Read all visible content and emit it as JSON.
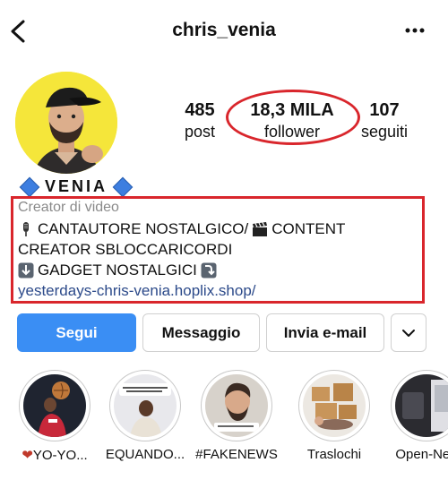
{
  "header": {
    "username": "chris_venia"
  },
  "stats": {
    "posts": {
      "value": "485",
      "label": "post"
    },
    "followers": {
      "value": "18,3 MILA",
      "label": "follower"
    },
    "following": {
      "value": "107",
      "label": "seguiti"
    }
  },
  "profile": {
    "display_name": "VENIA",
    "category": "Creator di video",
    "bio_line1_a": "CANTAUTORE NOSTALGICO/",
    "bio_line1_b": "CONTENT",
    "bio_line2": "CREATOR SBLOCCARICORDI",
    "bio_line3": "GADGET NOSTALGICI",
    "link": "yesterdays-chris-venia.hoplix.shop/"
  },
  "actions": {
    "follow": "Segui",
    "message": "Messaggio",
    "email": "Invia e-mail"
  },
  "highlights": [
    {
      "label": "YO-YO..."
    },
    {
      "label": "EQUANDO..."
    },
    {
      "label": "#FAKENEWS"
    },
    {
      "label": "Traslochi"
    },
    {
      "label": "Open-Nea"
    }
  ],
  "colors": {
    "accent": "#3a8ef4",
    "annotation": "#d9262c",
    "link": "#2c4a8a",
    "avatar_bg": "#f5e63a"
  },
  "icons": {
    "back": "chevron-left-icon",
    "more": "more-horizontal-icon",
    "dropdown": "chevron-down-icon"
  }
}
